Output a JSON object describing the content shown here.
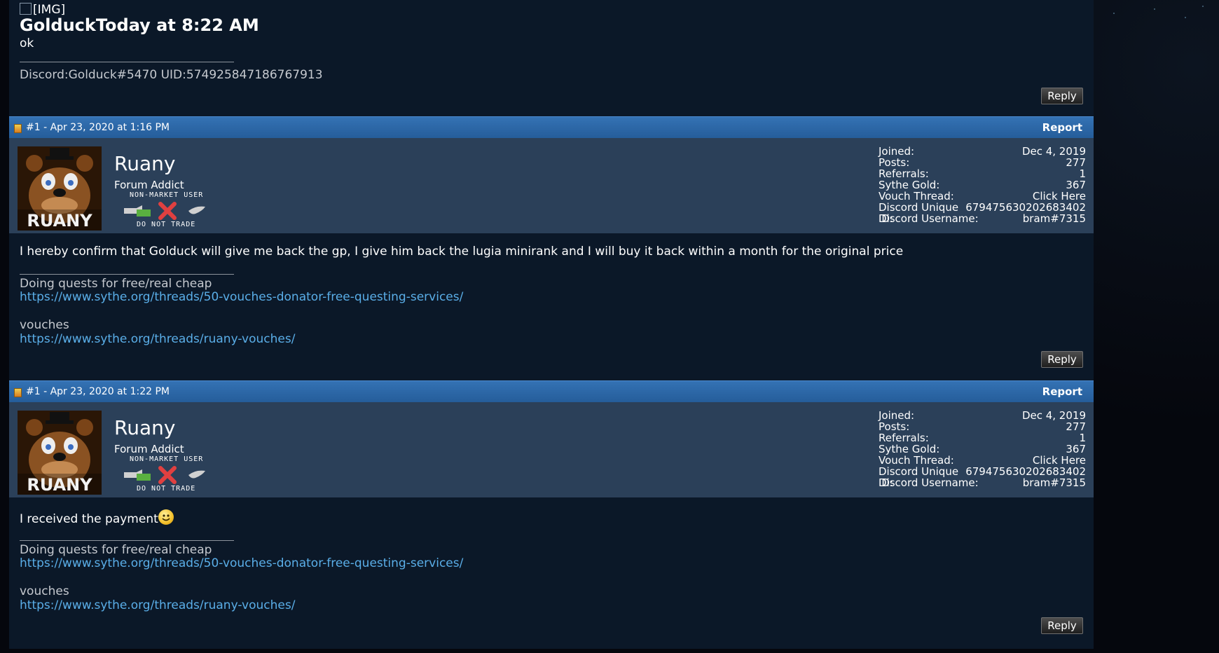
{
  "quoted": {
    "img_placeholder": "[IMG]",
    "header": "GolduckToday at 8:22 AM",
    "body": "ok",
    "signature": "Discord:Golduck#5470 UID:574925847186767913"
  },
  "reply_label": "Reply",
  "report_label": "Report",
  "avatar_text": "RUANY",
  "badge": {
    "top": "NON-MARKET USER",
    "bottom": "DO NOT TRADE"
  },
  "stat_labels": {
    "joined": "Joined:",
    "posts": "Posts:",
    "referrals": "Referrals:",
    "gold": "Sythe Gold:",
    "vouch": "Vouch Thread:",
    "discord_id": "Discord Unique ID:",
    "discord_user": "Discord Username:"
  },
  "posts": [
    {
      "header": "#1 - Apr 23, 2020 at 1:16 PM",
      "username": "Ruany",
      "user_title": "Forum Addict",
      "stats": {
        "joined": "Dec 4, 2019",
        "posts": "277",
        "referrals": "1",
        "gold": "367",
        "vouch": "Click Here",
        "discord_id": "679475630202683402",
        "discord_user": "bram#7315"
      },
      "body": "I hereby confirm that Golduck will give me back the gp, I give him back the lugia minirank and I will buy it back within a month for the original price",
      "signature": {
        "line1": "Doing quests for free/real cheap",
        "link1": "https://www.sythe.org/threads/50-vouches-donator-free-questing-services/",
        "line2": "vouches",
        "link2": "https://www.sythe.org/threads/ruany-vouches/"
      }
    },
    {
      "header": "#1 - Apr 23, 2020 at 1:22 PM",
      "username": "Ruany",
      "user_title": "Forum Addict",
      "stats": {
        "joined": "Dec 4, 2019",
        "posts": "277",
        "referrals": "1",
        "gold": "367",
        "vouch": "Click Here",
        "discord_id": "679475630202683402",
        "discord_user": "bram#7315"
      },
      "body": "I received the payment",
      "signature": {
        "line1": "Doing quests for free/real cheap",
        "link1": "https://www.sythe.org/threads/50-vouches-donator-free-questing-services/",
        "line2": "vouches",
        "link2": "https://www.sythe.org/threads/ruany-vouches/"
      }
    }
  ]
}
